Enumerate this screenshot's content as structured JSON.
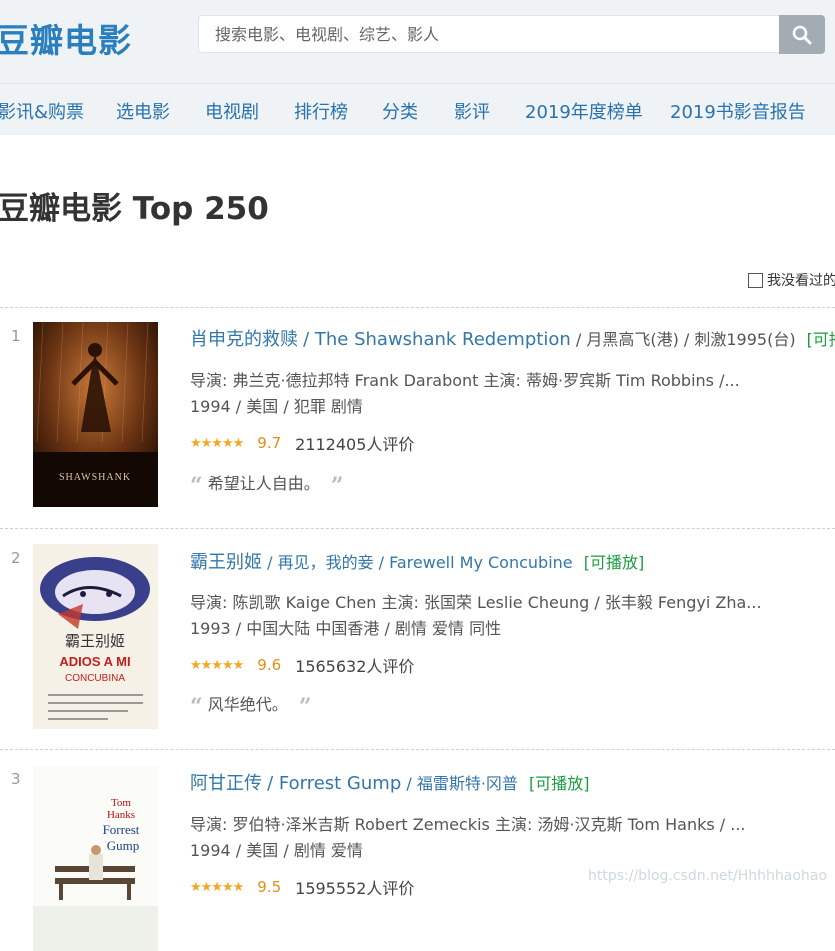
{
  "header": {
    "logo": "豆瓣电影",
    "search_placeholder": "搜索电影、电视剧、综艺、影人"
  },
  "nav": [
    "影讯&购票",
    "选电影",
    "电视剧",
    "排行榜",
    "分类",
    "影评",
    "2019年度榜单",
    "2019书影音报告"
  ],
  "page_title": "豆瓣电影 Top 250",
  "filter": {
    "label": "我没看过的"
  },
  "movies": [
    {
      "rank": "1",
      "title": "肖申克的救赎",
      "other_title": "/ The Shawshank Redemption",
      "alt_title": "/ 月黑高飞(港) / 刺激1995(台)",
      "playable": "[可播放]",
      "credits": "导演: 弗兰克·德拉邦特 Frank Darabont   主演: 蒂姆·罗宾斯 Tim Robbins /...",
      "meta": "1994 / 美国 / 犯罪 剧情",
      "stars": "★★★★★",
      "score": "9.7",
      "votes": "2112405人评价",
      "quote": "希望让人自由。",
      "poster_text": "SHAWSHANK"
    },
    {
      "rank": "2",
      "title": "霸王别姬",
      "other_title": "/ 再见，我的妾 / Farewell My Concubine",
      "alt_title": "",
      "playable": "[可播放]",
      "credits": "导演: 陈凯歌 Kaige Chen   主演: 张国荣 Leslie Cheung / 张丰毅 Fengyi Zha...",
      "meta": "1993 / 中国大陆 中国香港 / 剧情 爱情 同性",
      "stars": "★★★★★",
      "score": "9.6",
      "votes": "1565632人评价",
      "quote": "风华绝代。",
      "poster_text": "ADIOS A MI"
    },
    {
      "rank": "3",
      "title": "阿甘正传",
      "other_title": "/ Forrest Gump",
      "alt_title": "/ 福雷斯特·冈普",
      "playable": "[可播放]",
      "credits": "导演: 罗伯特·泽米吉斯 Robert Zemeckis   主演: 汤姆·汉克斯 Tom Hanks / ...",
      "meta": "1994 / 美国 / 剧情 爱情",
      "stars": "★★★★★",
      "score": "9.5",
      "votes": "1595552人评价",
      "quote": "",
      "poster_text": "Forrest"
    }
  ],
  "watermark": "https://blog.csdn.net/Hhhhhaohao"
}
